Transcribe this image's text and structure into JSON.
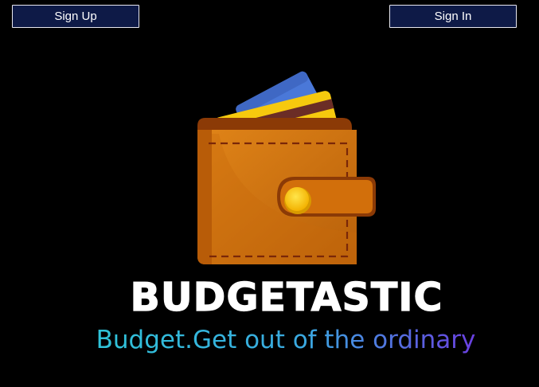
{
  "header": {
    "signup_label": "Sign Up",
    "signin_label": "Sign In"
  },
  "logo": {
    "brand_name": "BUDGETASTIC",
    "tagline": "Budget.Get out of the ordinary",
    "icon": "wallet-icon"
  },
  "colors": {
    "background": "#000000",
    "button_bg": "#0e1a47",
    "button_border": "#e8e8f0",
    "wallet": "#d0730c",
    "card_yellow": "#f6c90e",
    "card_blue": "#4a78d8"
  }
}
